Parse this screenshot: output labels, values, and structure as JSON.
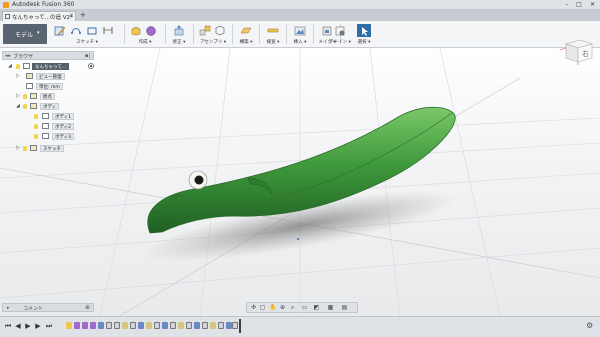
{
  "window": {
    "title": "Autodesk Fusion 360",
    "min": "–",
    "max": "□",
    "close": "✕"
  },
  "tab": {
    "label": "なんちゃって...の追 V2*",
    "close": "×",
    "add": "+"
  },
  "toolbar": {
    "workspace": "モデル",
    "workspace_arrow": "▾",
    "groups": [
      {
        "label": "スケッチ ▾"
      },
      {
        "label": "作成 ▾"
      },
      {
        "label": "修正 ▾"
      },
      {
        "label": "アセンブリ ▾"
      },
      {
        "label": "構築 ▾"
      },
      {
        "label": "検査 ▾"
      },
      {
        "label": "挿入 ▾"
      },
      {
        "label": "メイク ▾"
      },
      {
        "label": "アドイン ▾"
      },
      {
        "label": "選択 ▾"
      }
    ]
  },
  "browser": {
    "title": "ブラウザ",
    "toggle": "◂◂",
    "pin": "▪|",
    "root_label": "なんちゃって...",
    "items": [
      {
        "label": "ビュー管理"
      },
      {
        "label": "単位: mm"
      },
      {
        "label": "原点"
      },
      {
        "label": "ボディ"
      },
      {
        "label": "ボディ1"
      },
      {
        "label": "ボディ2"
      },
      {
        "label": "ボディ3"
      },
      {
        "label": "スケッチ"
      }
    ]
  },
  "viewcube": {
    "face_label": "右"
  },
  "comments": {
    "title": "コメント",
    "toggle": "▸",
    "pin": "⊕"
  },
  "navbar": {
    "icons": [
      "orbit-icon",
      "pan-icon",
      "zoom-icon",
      "fit-icon",
      "display-icon",
      "grid-icon",
      "viewports-icon"
    ]
  },
  "timeline": {
    "controls": [
      "⏮",
      "◀",
      "▶",
      "▶",
      "⏭"
    ],
    "gear": "⚙"
  },
  "colors": {
    "body_green": "#3f9a3c",
    "body_highlight": "#8fd07f",
    "accent_blue": "#2e6ea6"
  }
}
